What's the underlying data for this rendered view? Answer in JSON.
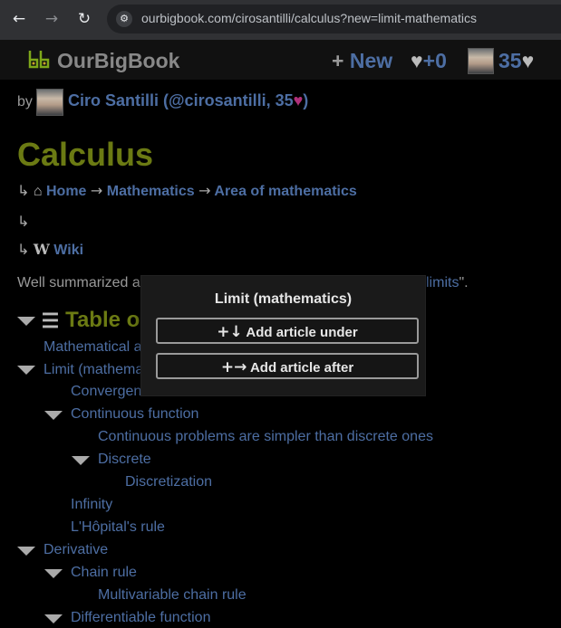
{
  "browser": {
    "back_icon": "←",
    "forward_icon": "→",
    "reload_icon": "↻",
    "site_info_icon": "⚙",
    "url": "ourbigbook.com/cirosantilli/calculus?new=limit-mathematics"
  },
  "topbar": {
    "logo_text": "OurBigBook",
    "new_icon": "+",
    "new_label": "New",
    "likes_icon": "♥",
    "likes_count": "+0",
    "user_score": "35",
    "score_icon": "♥"
  },
  "byline": {
    "by": "by",
    "author_prefix": "Ciro Santilli (@cirosantilli, 35",
    "author_heart": "♥",
    "author_suffix": ")"
  },
  "article": {
    "title": "Calculus",
    "breadcrumb": {
      "lead_icon": "↳",
      "home_icon": "⌂",
      "home": "Home",
      "arrow": "→",
      "mathematics": "Mathematics",
      "area": "Area of mathematics"
    },
    "empty_line_icon": "↳",
    "wiki": {
      "lead_icon": "↳",
      "w_icon": "W",
      "label": "Wiki"
    },
    "summary_start": "Well summarized a",
    "summary_link": "limits",
    "summary_end": "\"."
  },
  "toc": {
    "heading": "Table o",
    "list_icon": "☰",
    "items": [
      {
        "label": "Mathematical a"
      },
      {
        "label": "Limit (mathema"
      },
      {
        "label": "Convergent series"
      },
      {
        "label": "Continuous function"
      },
      {
        "label": "Continuous problems are simpler than discrete ones"
      },
      {
        "label": "Discrete"
      },
      {
        "label": "Discretization"
      },
      {
        "label": "Infinity"
      },
      {
        "label": "L'Hôpital's rule"
      },
      {
        "label": "Derivative"
      },
      {
        "label": "Chain rule"
      },
      {
        "label": "Multivariable chain rule"
      },
      {
        "label": "Differentiable function"
      }
    ]
  },
  "popup": {
    "title": "Limit (mathematics)",
    "under_icon": "+↓",
    "under_label": "Add article under",
    "after_icon": "+→",
    "after_label": "Add article after"
  },
  "colors": {
    "title_olive": "#6b7a13",
    "link_blue": "#4d6ea3",
    "heart_pink": "#b0307a",
    "page_bg": "#000000",
    "popup_bg": "#1a1a1a"
  }
}
